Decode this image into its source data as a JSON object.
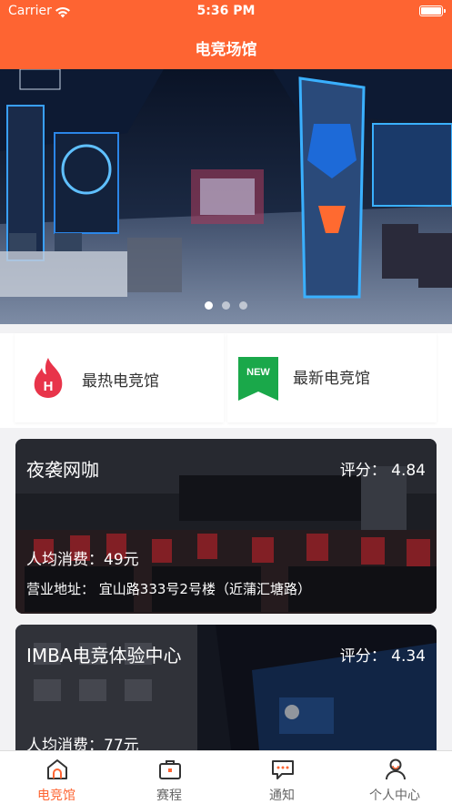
{
  "status_bar": {
    "carrier": "Carrier",
    "time": "5:36 PM",
    "battery_level": 1.0
  },
  "nav": {
    "title": "电竞场馆"
  },
  "banner": {
    "page_count": 3,
    "active_page": 1
  },
  "categories": [
    {
      "label": "最热电竞馆",
      "icon": "hot-flame-icon",
      "icon_text": "H",
      "color": "#e8344a"
    },
    {
      "label": "最新电竞馆",
      "icon": "new-ribbon-icon",
      "icon_text": "NEW",
      "color": "#1aa84a"
    }
  ],
  "venues": [
    {
      "name": "夜袭网咖",
      "rating_label": "评分：",
      "rating": "4.84",
      "price_label": "人均消费：",
      "price": "49元",
      "address_label": "营业地址：",
      "address": "宜山路333号2号楼（近蒲汇塘路）"
    },
    {
      "name": "IMBA电竞体验中心",
      "rating_label": "评分：",
      "rating": "4.34",
      "price_label": "人均消费：",
      "price": "77元"
    }
  ],
  "tabs": [
    {
      "label": "电竞馆",
      "icon": "venue-home-icon",
      "active": true
    },
    {
      "label": "赛程",
      "icon": "schedule-briefcase-icon",
      "active": false
    },
    {
      "label": "通知",
      "icon": "notification-chat-icon",
      "active": false
    },
    {
      "label": "个人中心",
      "icon": "profile-user-icon",
      "active": false
    }
  ],
  "colors": {
    "accent": "#fe6432",
    "hot": "#e8344a",
    "new": "#1aa84a"
  }
}
